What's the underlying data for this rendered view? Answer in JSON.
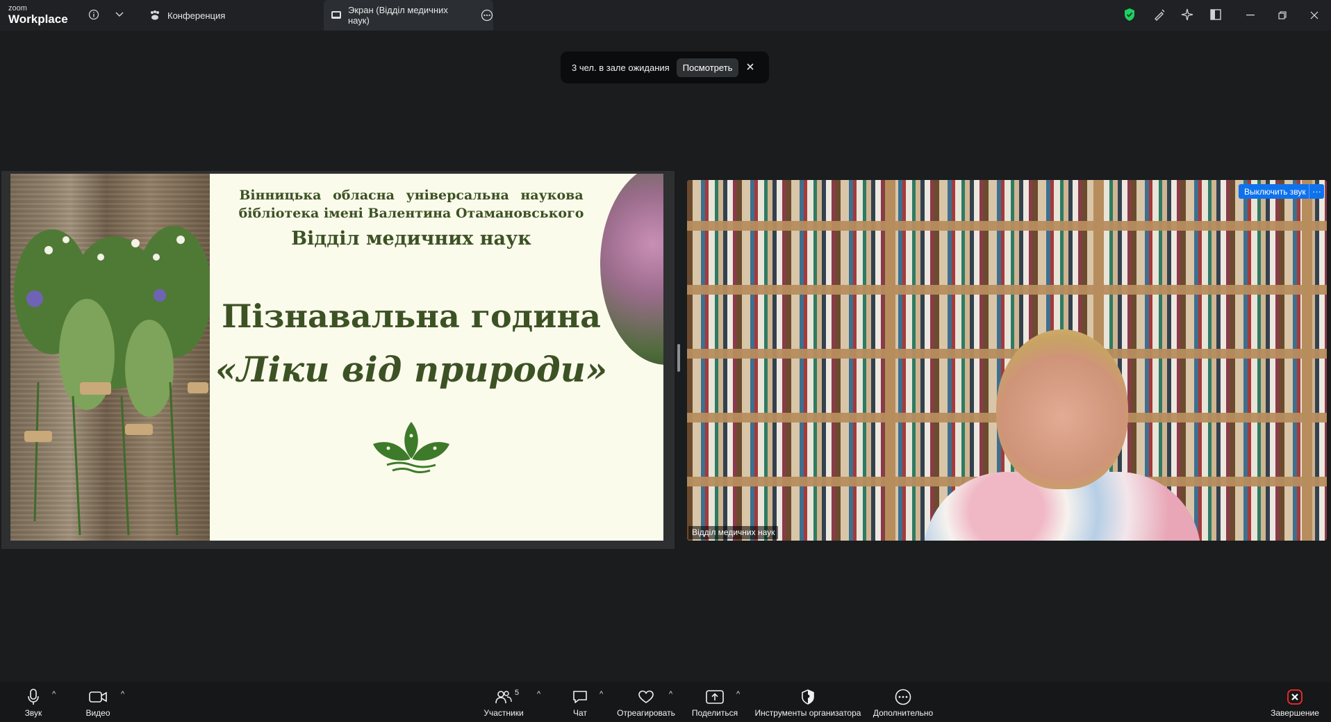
{
  "app": {
    "logo_small": "zoom",
    "logo_big": "Workplace"
  },
  "tabs": [
    {
      "label": "Конференция"
    },
    {
      "label": "Экран (Відділ медичних наук)"
    }
  ],
  "waiting_room": {
    "message": "3 чел. в зале ожидания",
    "view_label": "Посмотреть"
  },
  "slide": {
    "line1": "Вінницька обласна універсальна наукова",
    "line2": "бібліотека імені Валентина Отамановського",
    "line3": "Відділ медичних наук",
    "title": "Пізнавальна година",
    "subtitle": "«Ліки від природи»"
  },
  "video": {
    "participant_name": "Відділ медичних наук",
    "unmute_label": "Выключить звук",
    "more_label": "···"
  },
  "toolbar": {
    "audio": "Звук",
    "video": "Видео",
    "participants": "Участники",
    "participants_count": "5",
    "chat": "Чат",
    "react": "Отреагировать",
    "share": "Поделиться",
    "host_tools": "Инструменты организатора",
    "more": "Дополнительно",
    "end": "Завершение"
  },
  "colors": {
    "accent_blue": "#0e72ed",
    "shield_green": "#1ecf62",
    "end_red": "#e02828",
    "slide_green": "#3c5224"
  }
}
